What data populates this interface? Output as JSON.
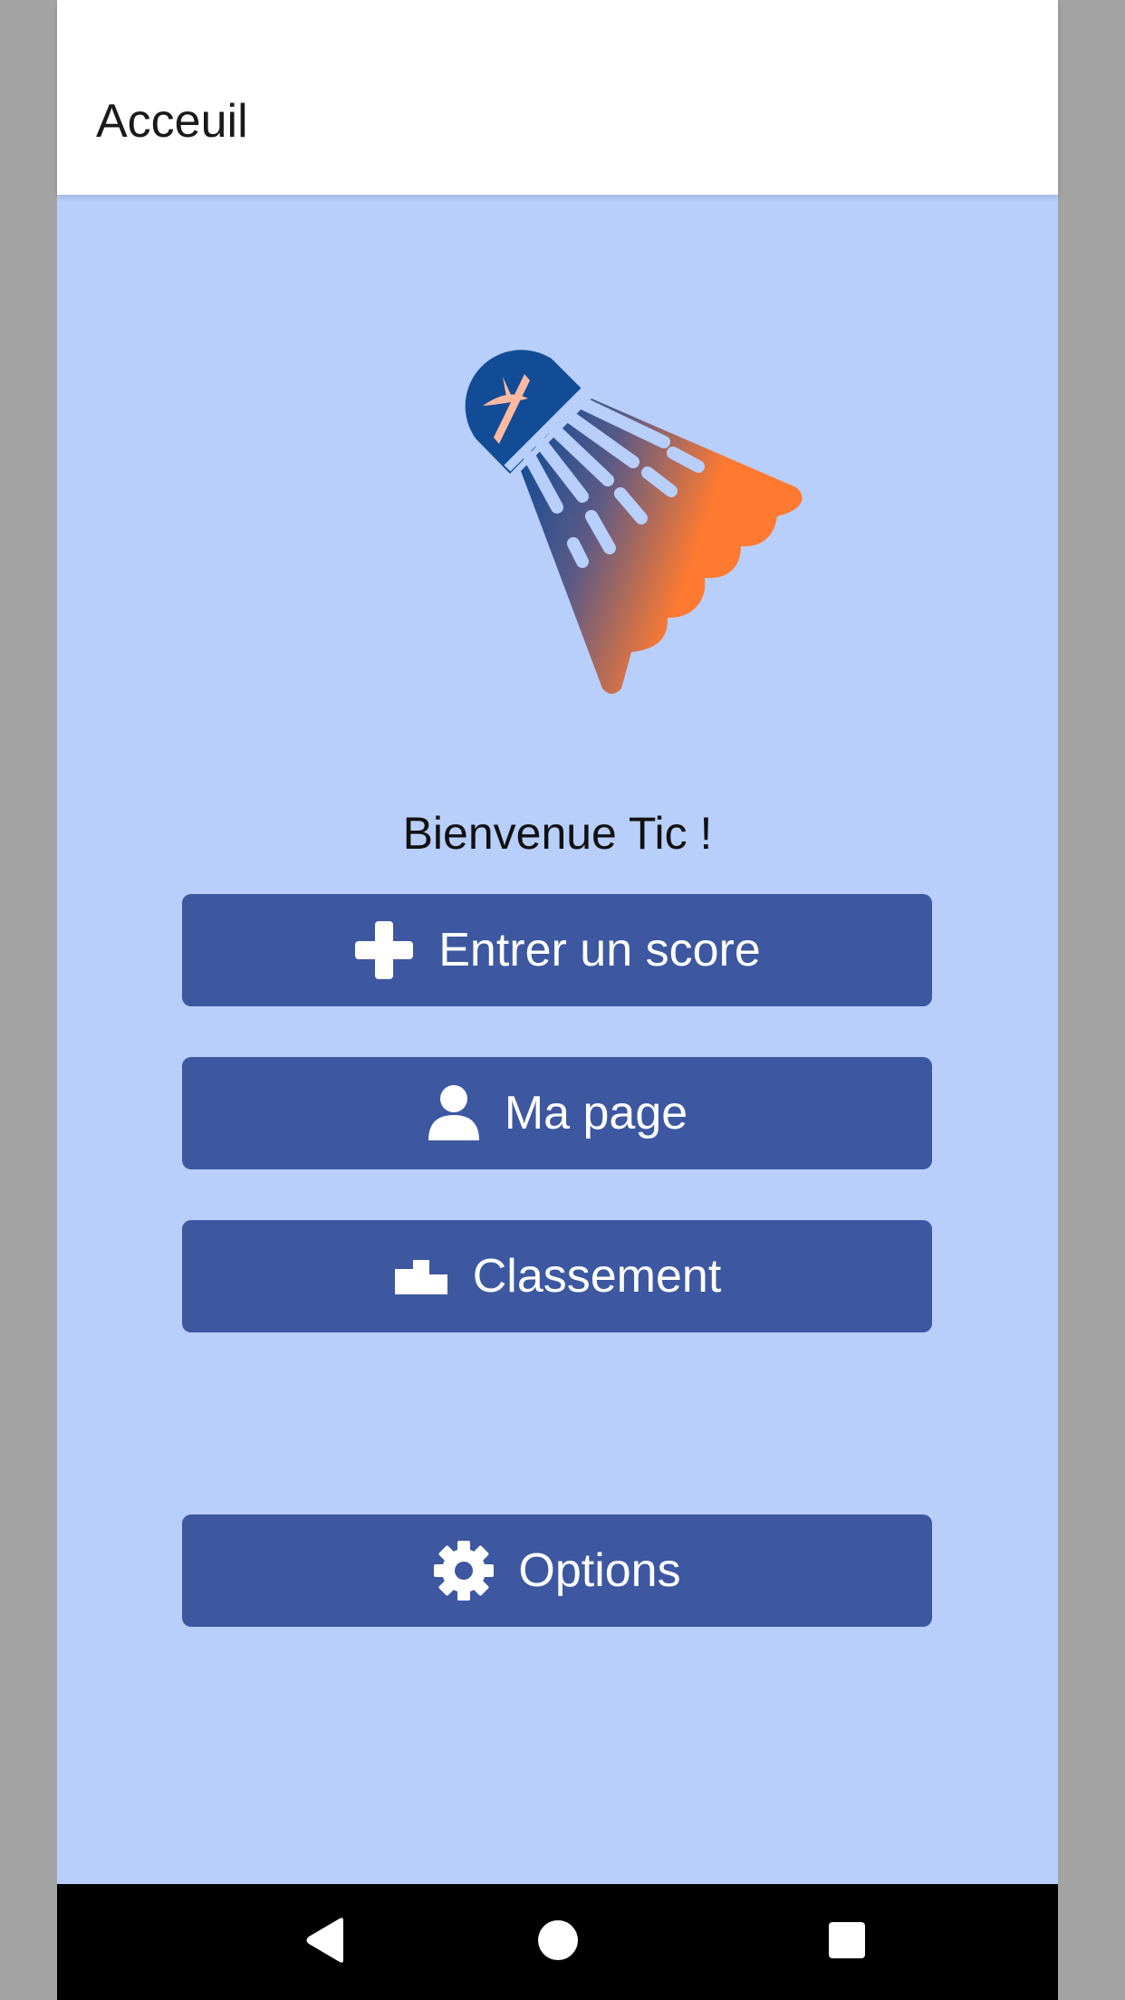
{
  "header": {
    "title": "Acceuil"
  },
  "logo": {
    "name": "shuttlecock-logo",
    "colors": {
      "blue": "#124c96",
      "orange": "#ff7a30",
      "accent": "#ffb9a0"
    }
  },
  "welcome": {
    "text": "Bienvenue Tic !"
  },
  "menu": {
    "buttons": [
      {
        "label": "Entrer un score",
        "icon": "plus-icon"
      },
      {
        "label": "Ma page",
        "icon": "person-icon"
      },
      {
        "label": "Classement",
        "icon": "podium-icon"
      },
      {
        "label": "Options",
        "icon": "gear-icon"
      }
    ]
  },
  "navigation": {
    "items": [
      "back-icon",
      "home-icon",
      "recents-icon"
    ]
  },
  "colors": {
    "background": "#b8cffc",
    "button": "#3d58a0",
    "header": "#ffffff",
    "nav_bar": "#000000"
  }
}
